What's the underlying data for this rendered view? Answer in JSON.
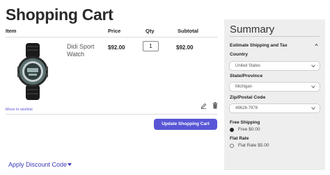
{
  "page": {
    "title": "Shopping Cart"
  },
  "cart": {
    "columns": {
      "item": "Item",
      "price": "Price",
      "qty": "Qty",
      "subtotal": "Subtotal"
    },
    "row": {
      "name": "Didi Sport Watch",
      "price": "$92.00",
      "qty": "1",
      "subtotal": "$92.00",
      "wishlist": "Move to wishlist"
    },
    "update_label": "Update Shopping Cart",
    "discount_label": "Apply Discount Code"
  },
  "summary": {
    "title": "Summary",
    "section": "Estimate Shipping and Tax",
    "country_label": "Country",
    "country_value": "United States",
    "state_label": "State/Province",
    "state_value": "Michigan",
    "zip_label": "Zip/Postal Code",
    "zip_value": "49628-7978",
    "free_label": "Free Shipping",
    "free_option": "Free $0.00",
    "flat_label": "Flat Rate",
    "flat_option": "Flat Rate $5.00"
  },
  "colors": {
    "accent": "#5856d6",
    "link": "#3b39b8",
    "panel": "#eeeeee"
  },
  "icons": [
    "watch-image",
    "pencil-icon",
    "trash-icon",
    "chevron-down-icon",
    "chevron-up-icon"
  ]
}
